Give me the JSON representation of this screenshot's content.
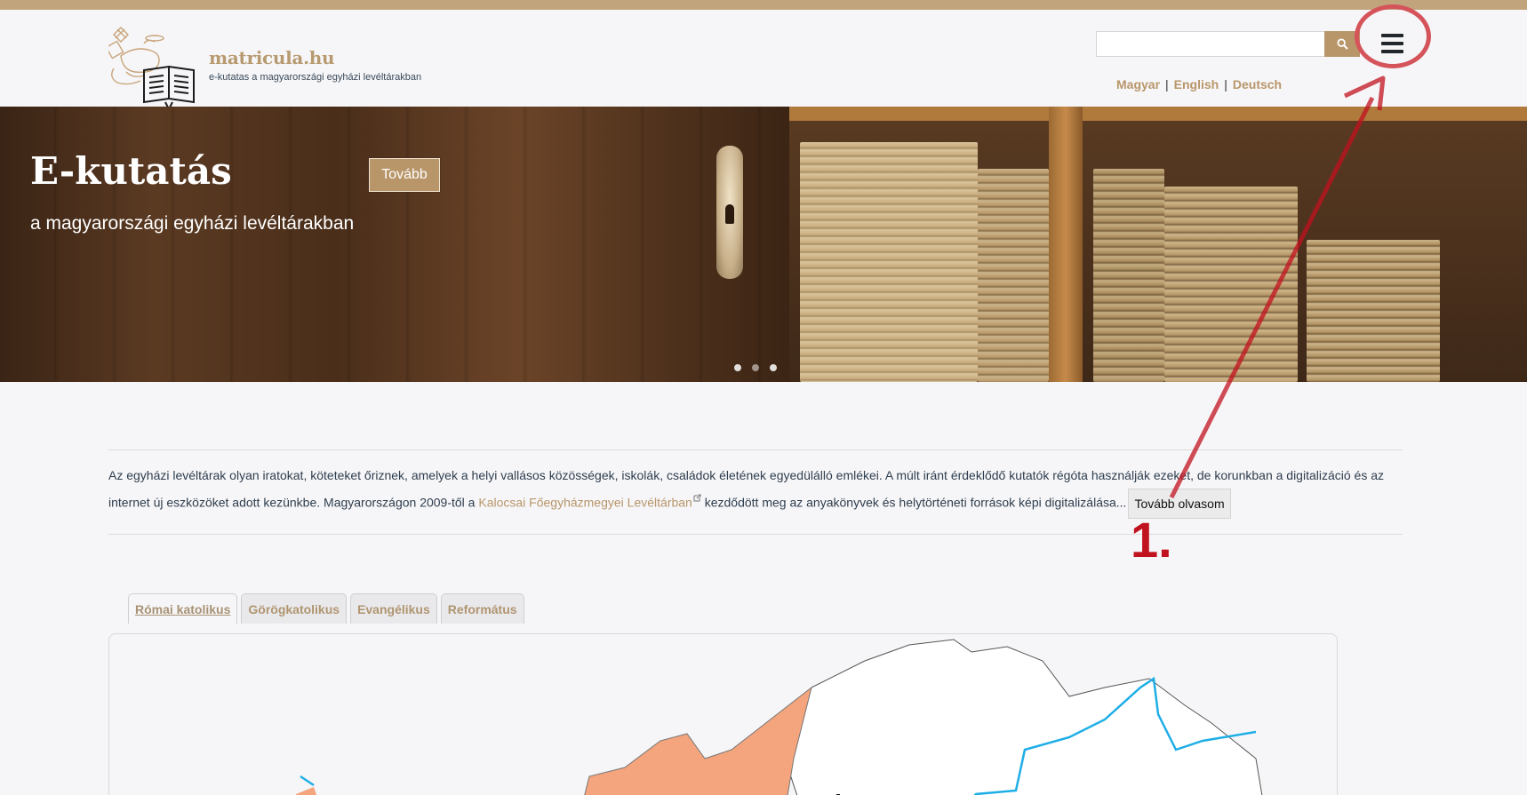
{
  "header": {
    "site_name": "matricula.hu",
    "tagline": "e-kutatas a magyarországi egyházi levéltárakban",
    "search": {
      "placeholder": "",
      "value": ""
    },
    "languages": [
      "Magyar",
      "English",
      "Deutsch"
    ]
  },
  "hero": {
    "title": "E-kutatás",
    "subtitle": "a magyarországi egyházi levéltárakban",
    "button_label": "Tovább",
    "slide_count": 3
  },
  "intro": {
    "text_before": "Az egyházi levéltárak olyan iratokat, köteteket őriznek, amelyek a helyi vallásos közösségek, iskolák, családok életének egyedülálló emlékei. A múlt iránt érdeklődő kutatók régóta használják ezeket, de korunkban a digitalizáció és az internet új eszközöket adott kezünkbe. Magyarországon 2009-től a ",
    "link_text": "Kalocsai Főegyházmegyei Levéltárban",
    "text_after": " kezdődött meg az anyakönyvek és helytörténeti források képi digitalizálása...",
    "more_button": "Tovább olvasom"
  },
  "tabs": [
    {
      "label": "Római katolikus",
      "active": true
    },
    {
      "label": "Görögkatolikus",
      "active": false
    },
    {
      "label": "Evangélikus",
      "active": false
    },
    {
      "label": "Református",
      "active": false
    }
  ],
  "annotation": {
    "label": "1."
  },
  "colors": {
    "accent": "#b8966a",
    "topbar": "#c1a47c",
    "annotation_red": "#c1121f",
    "map_orange": "#f4a57d",
    "map_blue": "#1eaee6"
  }
}
